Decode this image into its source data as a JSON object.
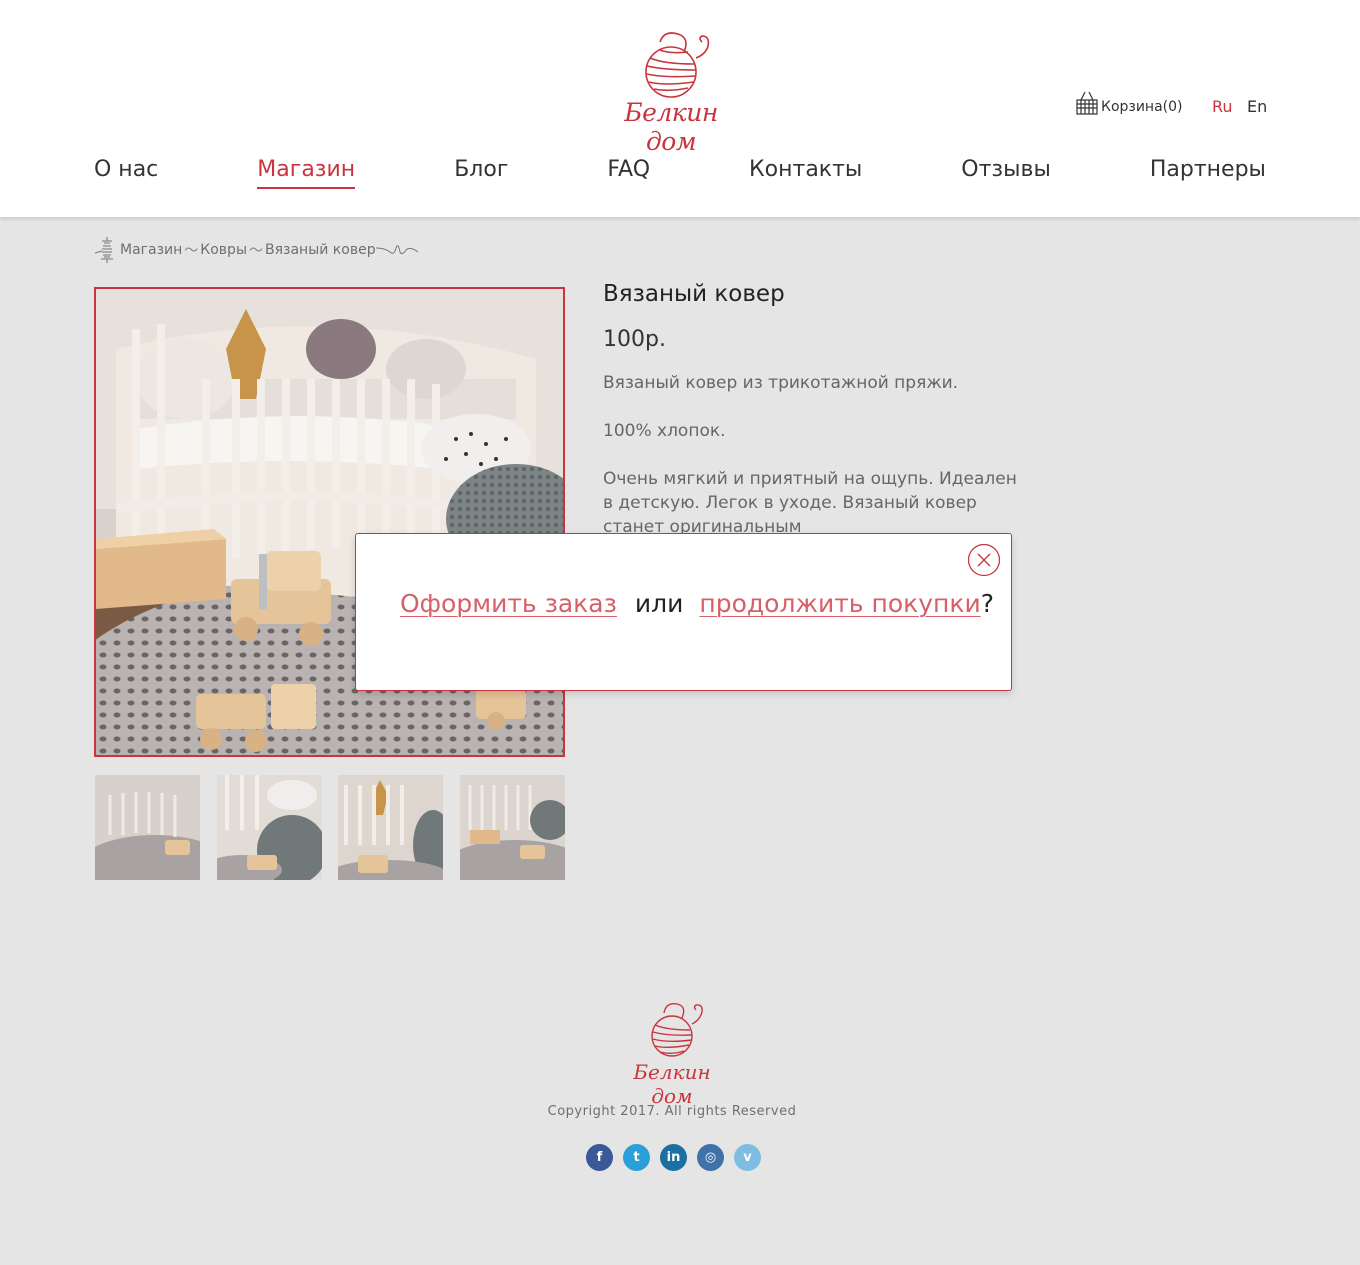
{
  "header": {
    "brand": "Белкин дом",
    "cart_label": "Корзина(0)",
    "lang_ru": "Ru",
    "lang_en": "En",
    "nav": [
      "О нас",
      "Магазин",
      "Блог",
      "FAQ",
      "Контакты",
      "Отзывы",
      "Партнеры"
    ],
    "active_nav": "Магазин"
  },
  "breadcrumb": [
    "Магазин",
    "Ковры",
    "Вязаный ковер"
  ],
  "product": {
    "title": "Вязаный ковер",
    "price": "100р.",
    "description": [
      "Вязаный ковер из трикотажной пряжи.",
      "100% хлопок.",
      "Очень мягкий и приятный на ощупь. Идеален в детскую. Легок в уходе. Вязаный ковер станет оригинальным"
    ]
  },
  "modal": {
    "checkout_link": "Оформить заказ",
    "or_text": "или",
    "continue_link": "продолжить покупки",
    "question_mark": "?"
  },
  "footer": {
    "brand": "Белкин дом",
    "copyright": "Copyright 2017. All rights Reserved",
    "socials": [
      {
        "name": "facebook",
        "glyph": "f",
        "color": "#3b5998"
      },
      {
        "name": "twitter",
        "glyph": "t",
        "color": "#2a9fd8"
      },
      {
        "name": "linkedin",
        "glyph": "in",
        "color": "#1b6fa3"
      },
      {
        "name": "instagram",
        "glyph": "◎",
        "color": "#3f72a8"
      },
      {
        "name": "vimeo",
        "glyph": "v",
        "color": "#7fbde0"
      }
    ]
  },
  "colors": {
    "accent": "#c8353e",
    "link": "#d76068",
    "background": "#e6e5e5"
  }
}
